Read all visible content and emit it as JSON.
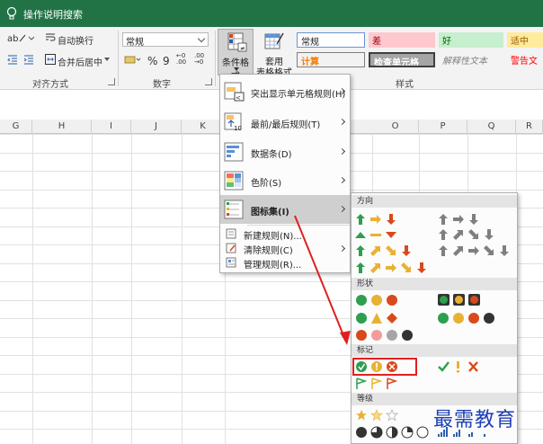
{
  "titlebar": {
    "search_tip": "操作说明搜索"
  },
  "ribbon": {
    "alignment": {
      "wrap_label": "自动换行",
      "merge_label": "合并后居中",
      "group_label": "对齐方式"
    },
    "number": {
      "format_value": "常规",
      "percent_symbol": "%",
      "comma_symbol": "9",
      "inc_decimal": "←0 .00",
      "dec_decimal": ".00 →0",
      "group_label": "数字"
    },
    "cond_format": {
      "label": "条件格式"
    },
    "table_format": {
      "label_line1": "套用",
      "label_line2": "表格格式"
    },
    "styles": {
      "group_label": "样式",
      "cells": [
        {
          "label": "常规"
        },
        {
          "label": "差"
        },
        {
          "label": "好"
        },
        {
          "label": "适中"
        },
        {
          "label": "计算"
        },
        {
          "label": "检查单元格"
        },
        {
          "label": "解释性文本"
        },
        {
          "label": "警告文"
        }
      ]
    }
  },
  "columns": [
    "G",
    "H",
    "I",
    "J",
    "K",
    "O",
    "P",
    "Q",
    "R"
  ],
  "cf_menu": {
    "items": [
      {
        "label": "突出显示单元格规则(H)"
      },
      {
        "label": "最前/最后规则(T)"
      },
      {
        "label": "数据条(D)"
      },
      {
        "label": "色阶(S)"
      },
      {
        "label": "图标集(I)"
      },
      {
        "label": "新建规则(N)..."
      },
      {
        "label": "清除规则(C)"
      },
      {
        "label": "管理规则(R)..."
      }
    ]
  },
  "icon_menu": {
    "sections": [
      {
        "label": "方向"
      },
      {
        "label": "形状"
      },
      {
        "label": "标记"
      },
      {
        "label": "等级"
      }
    ]
  },
  "watermark": "最需教育",
  "colors": {
    "title_green": "#217346",
    "bad_bg": "#ffc7ce",
    "bad_fg": "#9c0006",
    "good_bg": "#c6efce",
    "good_fg": "#006100",
    "neutral_bg": "#ffeb9c",
    "neutral_fg": "#9c5700",
    "calc_fg": "#fa7d00",
    "check_bg": "#a5a5a5",
    "warn_fg": "#ff0000",
    "arrow_green": "#2e9e4f",
    "arrow_yellow": "#e9b134",
    "arrow_red": "#d84a1b",
    "highlight_red": "#e02020"
  }
}
